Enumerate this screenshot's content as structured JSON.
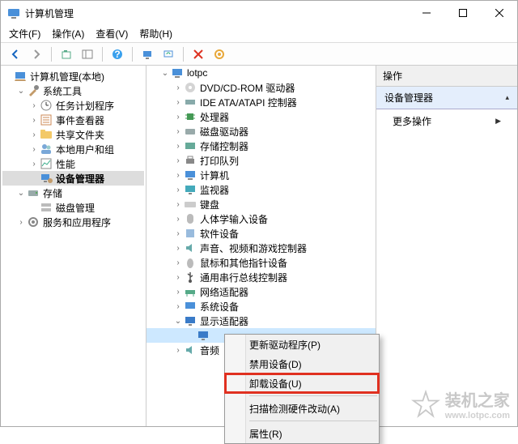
{
  "window": {
    "title": "计算机管理"
  },
  "menu": {
    "file": "文件(F)",
    "action": "操作(A)",
    "view": "查看(V)",
    "help": "帮助(H)"
  },
  "left": {
    "root": "计算机管理(本地)",
    "sys_tools": "系统工具",
    "task_sched": "任务计划程序",
    "event_viewer": "事件查看器",
    "shared": "共享文件夹",
    "local_users": "本地用户和组",
    "perf": "性能",
    "dev_mgr": "设备管理器",
    "storage": "存储",
    "disk_mgmt": "磁盘管理",
    "services": "服务和应用程序"
  },
  "mid": {
    "root": "lotpc",
    "dvd": "DVD/CD-ROM 驱动器",
    "ide": "IDE ATA/ATAPI 控制器",
    "cpu": "处理器",
    "disk_drives": "磁盘驱动器",
    "storage_ctrl": "存储控制器",
    "print_queue": "打印队列",
    "computer": "计算机",
    "monitor": "监视器",
    "keyboard": "键盘",
    "hid": "人体学输入设备",
    "software": "软件设备",
    "sound": "声音、视频和游戏控制器",
    "mouse": "鼠标和其他指针设备",
    "usb": "通用串行总线控制器",
    "network": "网络适配器",
    "system": "系统设备",
    "display": "显示适配器",
    "audio_io": "音频"
  },
  "actions": {
    "title": "操作",
    "section": "设备管理器",
    "more": "更多操作"
  },
  "context": {
    "update": "更新驱动程序(P)",
    "disable": "禁用设备(D)",
    "uninstall": "卸载设备(U)",
    "scan": "扫描检测硬件改动(A)",
    "properties": "属性(R)"
  },
  "watermark": {
    "text": "装机之家",
    "url": "www.lotpc.com"
  }
}
